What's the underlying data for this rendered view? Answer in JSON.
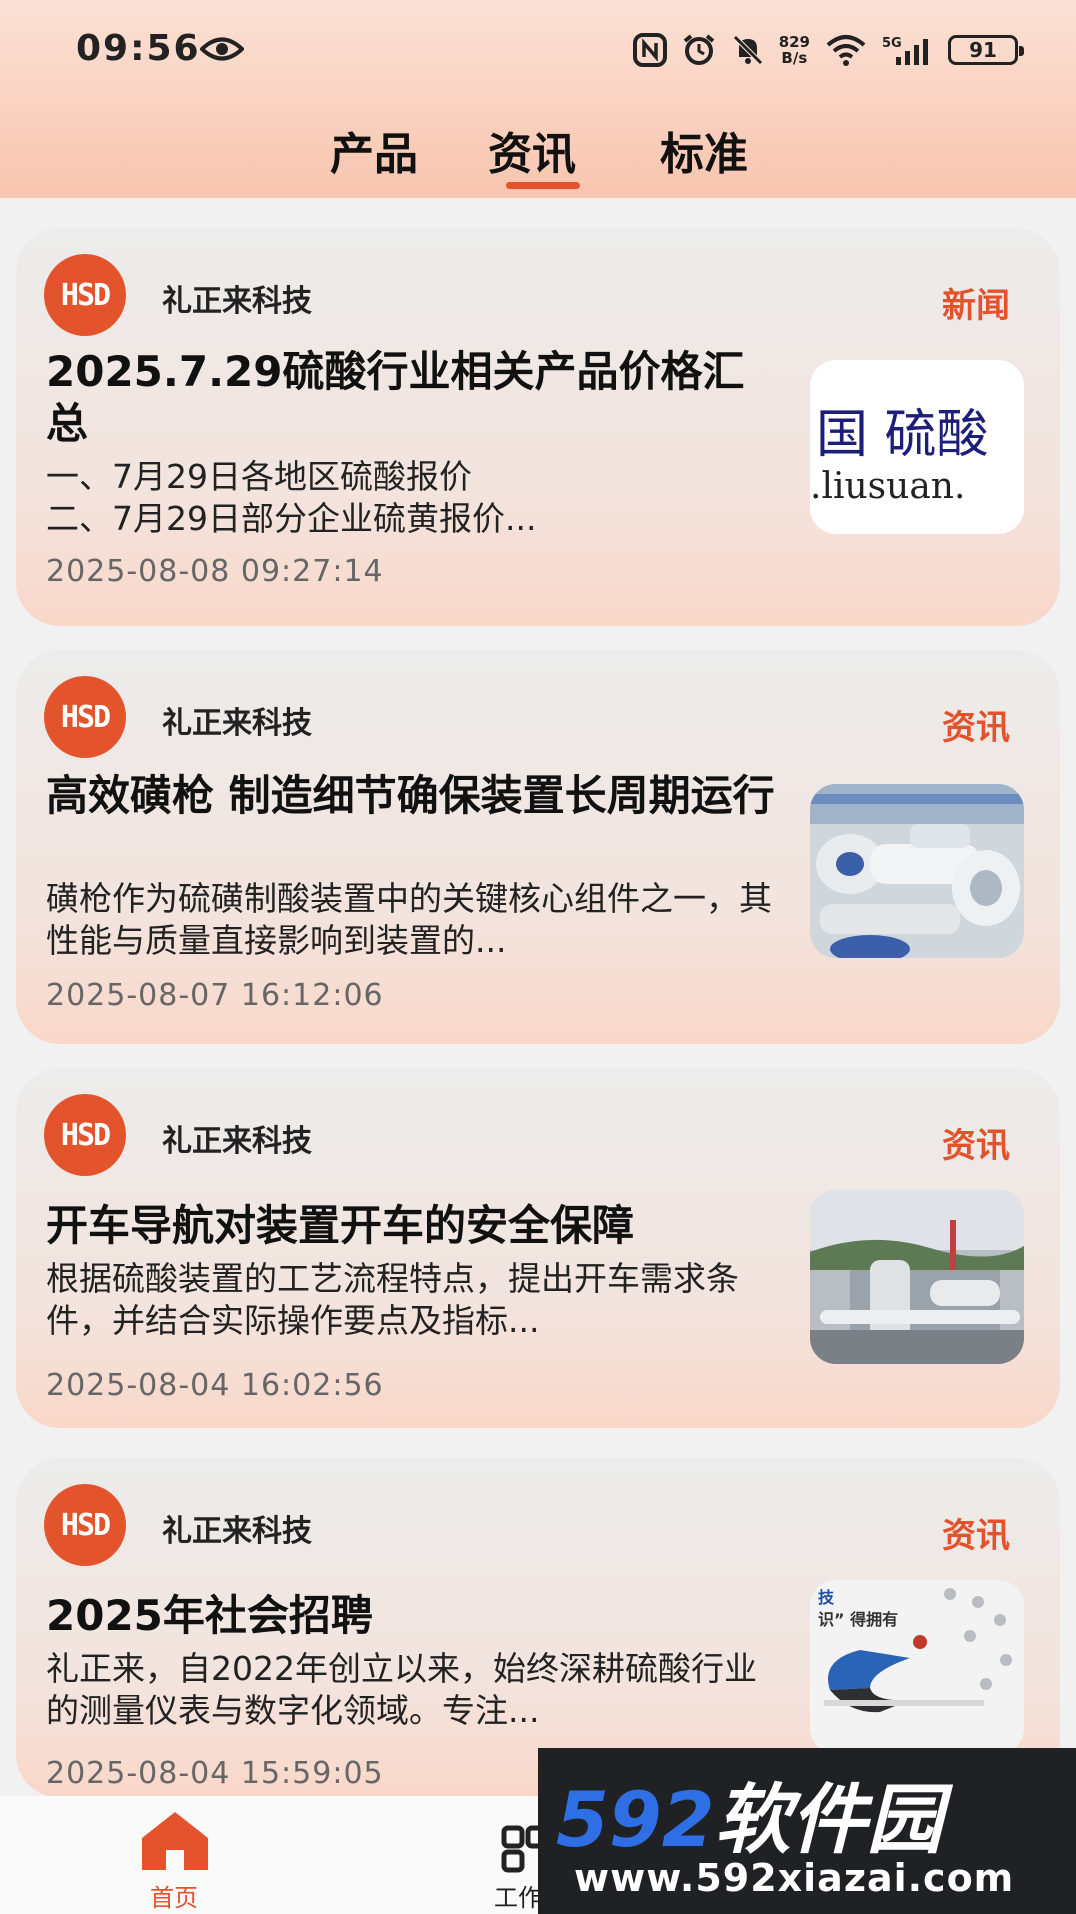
{
  "status_bar": {
    "time": "09:56",
    "net_speed_value": "829",
    "net_speed_unit": "B/s",
    "network": "5G",
    "battery": "91"
  },
  "tabs": [
    {
      "label": "产品",
      "active": false
    },
    {
      "label": "资讯",
      "active": true
    },
    {
      "label": "标准",
      "active": false
    }
  ],
  "brand": {
    "accent": "#e4532d"
  },
  "articles": [
    {
      "company": "礼正来科技",
      "logo_text": "HSD",
      "category": "新闻",
      "title": "2025.7.29硫酸行业相关产品价格汇总",
      "summary": "一、7月29日各地区硫酸报价\n二、7月29日部分企业硫黄报价...",
      "date": "2025-08-08 09:27:14",
      "thumb_text_line1": "国 硫酸",
      "thumb_text_line2": ".liusuan."
    },
    {
      "company": "礼正来科技",
      "logo_text": "HSD",
      "category": "资讯",
      "title": "高效磺枪 制造细节确保装置长周期运行",
      "summary": "磺枪作为硫磺制酸装置中的关键核心组件之一，其性能与质量直接影响到装置的...",
      "date": "2025-08-07 16:12:06"
    },
    {
      "company": "礼正来科技",
      "logo_text": "HSD",
      "category": "资讯",
      "title": "开车导航对装置开车的安全保障",
      "summary": "根据硫酸装置的工艺流程特点，提出开车需求条件，并结合实际操作要点及指标...",
      "date": "2025-08-04 16:02:56"
    },
    {
      "company": "礼正来科技",
      "logo_text": "HSD",
      "category": "资讯",
      "title": "2025年社会招聘",
      "summary": "礼正来，自2022年创立以来，始终深耕硫酸行业的测量仪表与数字化领域。专注...",
      "date": "2025-08-04 15:59:05",
      "thumb_text_line1": "技",
      "thumb_text_line2": "识” 得拥有"
    }
  ],
  "bottom_nav": {
    "home_label": "首页",
    "work_label": "工作"
  },
  "watermark": {
    "brand_num": "592",
    "brand_text": "软件园",
    "url": "www.592xiazai.com"
  }
}
